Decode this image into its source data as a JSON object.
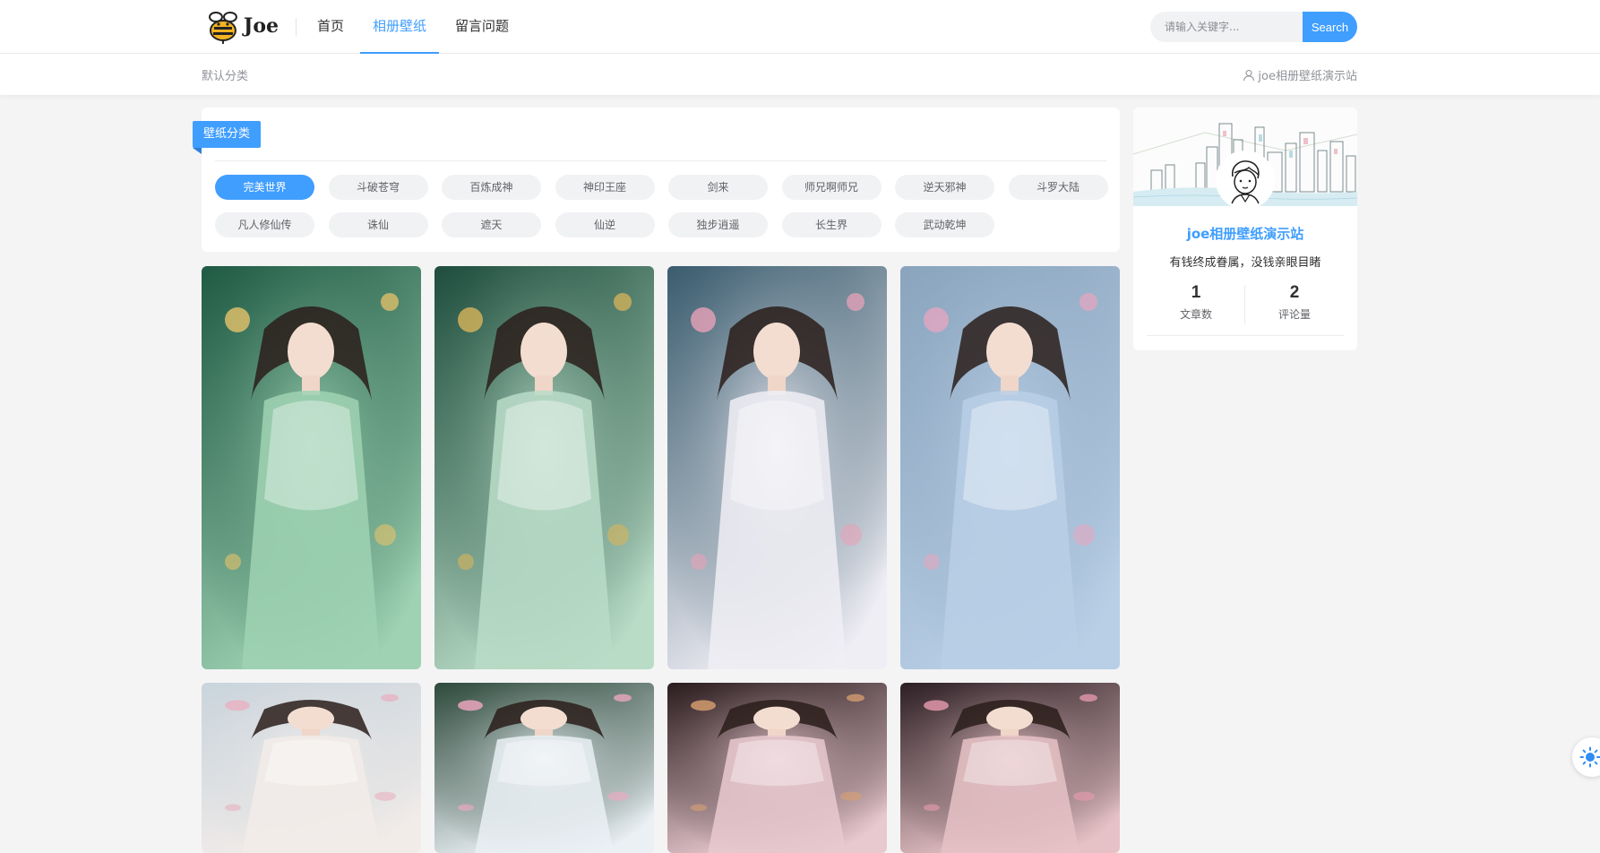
{
  "brand": {
    "name": "Joe",
    "accent": "#409eff"
  },
  "nav": {
    "items": [
      {
        "label": "首页"
      },
      {
        "label": "相册壁纸",
        "active": true
      },
      {
        "label": "留言问题"
      }
    ]
  },
  "search": {
    "placeholder": "请输入关键字...",
    "button_label": "Search"
  },
  "breadcrumb": {
    "label": "默认分类"
  },
  "site_link": {
    "label": "joe相册壁纸演示站",
    "icon": "user-icon"
  },
  "categories": {
    "title": "壁纸分类",
    "tags": [
      {
        "label": "完美世界",
        "active": true
      },
      {
        "label": "斗破苍穹"
      },
      {
        "label": "百炼成神"
      },
      {
        "label": "神印王座"
      },
      {
        "label": "剑来"
      },
      {
        "label": "师兄啊师兄"
      },
      {
        "label": "逆天邪神"
      },
      {
        "label": "斗罗大陆"
      },
      {
        "label": "凡人修仙传"
      },
      {
        "label": "诛仙"
      },
      {
        "label": "遮天"
      },
      {
        "label": "仙逆"
      },
      {
        "label": "独步逍遥"
      },
      {
        "label": "长生界"
      },
      {
        "label": "武动乾坤"
      }
    ]
  },
  "gallery": {
    "items": [
      {
        "palette": [
          "#1f5a44",
          "#9fd2b3",
          "#e6c36a"
        ]
      },
      {
        "palette": [
          "#1e4d3d",
          "#b9dcc7",
          "#d8b45a"
        ]
      },
      {
        "palette": [
          "#3a5c6e",
          "#f0eef5",
          "#e8a1b8"
        ]
      },
      {
        "palette": [
          "#8aa4bd",
          "#b8cfe6",
          "#e4a6c0"
        ]
      },
      {
        "palette": [
          "#c9d4dc",
          "#f2ece9",
          "#e8b0c0"
        ]
      },
      {
        "palette": [
          "#2e4a3c",
          "#eaf0f4",
          "#f2a9c2"
        ]
      },
      {
        "palette": [
          "#2a1c1e",
          "#e9c9d0",
          "#d9a070"
        ]
      },
      {
        "palette": [
          "#2c1f24",
          "#e6c2c6",
          "#e99bb0"
        ]
      }
    ]
  },
  "profile": {
    "name": "joe相册壁纸演示站",
    "motto": "有钱终成眷属，没钱亲眼目睹",
    "stats": [
      {
        "value": "1",
        "label": "文章数"
      },
      {
        "value": "2",
        "label": "评论量"
      }
    ]
  },
  "theme_toggle": {
    "icon": "sun-icon"
  }
}
